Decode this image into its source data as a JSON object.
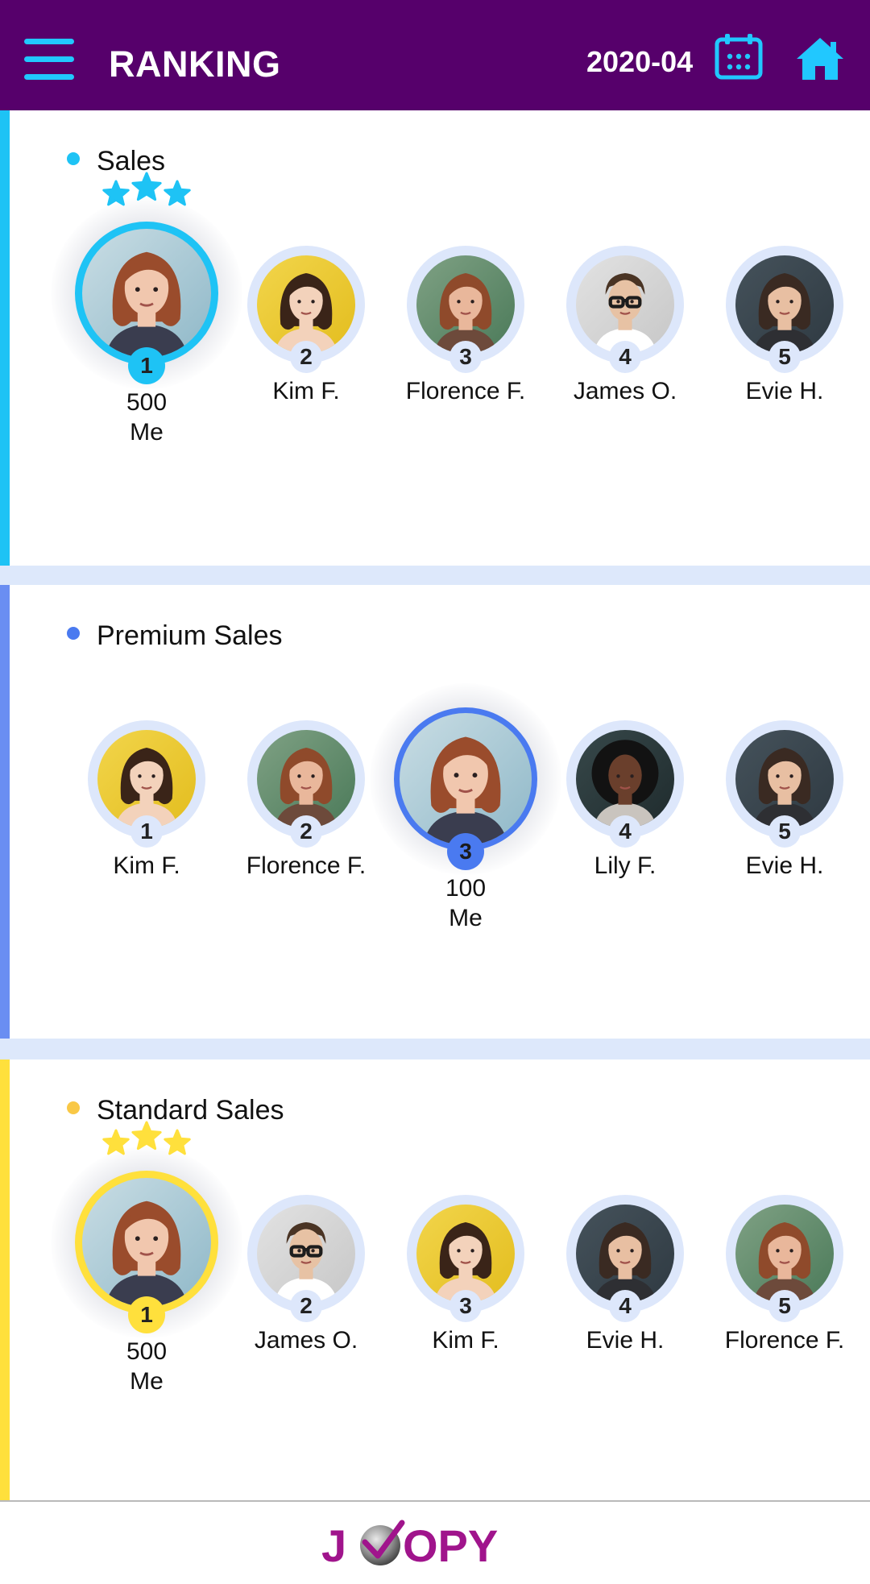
{
  "header": {
    "title": "RANKING",
    "period": "2020-04",
    "bar_color": "#56006b",
    "accent_color": "#21c8ff"
  },
  "categories": [
    {
      "title": "Sales",
      "color": "#1ec3f5",
      "entries": [
        {
          "rank": "1",
          "name": "Me",
          "score": "500",
          "is_me": true,
          "stars": 3,
          "avatar": "me"
        },
        {
          "rank": "2",
          "name": "Kim F.",
          "avatar": "kim"
        },
        {
          "rank": "3",
          "name": "Florence F.",
          "avatar": "florence"
        },
        {
          "rank": "4",
          "name": "James O.",
          "avatar": "james"
        },
        {
          "rank": "5",
          "name": "Evie H.",
          "avatar": "evie"
        }
      ]
    },
    {
      "title": "Premium Sales",
      "color": "#4a7af0",
      "entries": [
        {
          "rank": "1",
          "name": "Kim F.",
          "avatar": "kim"
        },
        {
          "rank": "2",
          "name": "Florence F.",
          "avatar": "florence"
        },
        {
          "rank": "3",
          "name": "Me",
          "score": "100",
          "is_me": true,
          "stars": 0,
          "avatar": "me"
        },
        {
          "rank": "4",
          "name": "Lily F.",
          "avatar": "lily"
        },
        {
          "rank": "5",
          "name": "Evie H.",
          "avatar": "evie"
        }
      ]
    },
    {
      "title": "Standard Sales",
      "color": "#ffe03c",
      "entries": [
        {
          "rank": "1",
          "name": "Me",
          "score": "500",
          "is_me": true,
          "stars": 3,
          "avatar": "me"
        },
        {
          "rank": "2",
          "name": "James O.",
          "avatar": "james"
        },
        {
          "rank": "3",
          "name": "Kim F.",
          "avatar": "kim"
        },
        {
          "rank": "4",
          "name": "Evie H.",
          "avatar": "evie"
        },
        {
          "rank": "5",
          "name": "Florence F.",
          "avatar": "florence"
        }
      ]
    }
  ],
  "icons": {
    "menu": "hamburger-menu-icon",
    "calendar": "calendar-icon",
    "home": "home-icon"
  },
  "footer": {
    "logo_text": "JOOPY",
    "logo_color": "#a0148c"
  }
}
